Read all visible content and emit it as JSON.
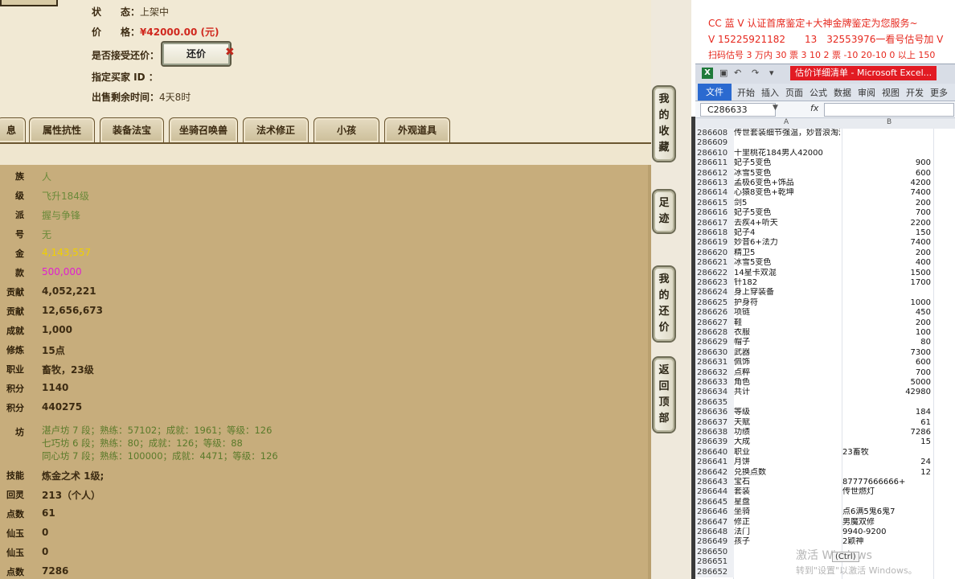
{
  "game": {
    "status": {
      "label": "状　　态：",
      "value": "上架中"
    },
    "price": {
      "label": "价　　格：",
      "value": "¥42000.00 (元)"
    },
    "counter_offer": {
      "label": "是否接受还价：",
      "button": "还价"
    },
    "buyer_id": {
      "label": "指定买家 ID ："
    },
    "remaining": {
      "label": "出售剩余时间：",
      "value": "4天8时"
    },
    "tabs": [
      "息",
      "属性抗性",
      "装备法宝",
      "坐骑召唤兽",
      "法术修正",
      "小孩",
      "外观道具"
    ],
    "side_buttons": [
      "我的收藏",
      "足迹",
      "我的还价",
      "返回顶部"
    ],
    "rows": [
      {
        "label": "族",
        "value": "人",
        "color": "#6b8a3a"
      },
      {
        "label": "级",
        "value": "飞升184级",
        "color": "#6b8a3a"
      },
      {
        "label": "派",
        "value": "握与争锋",
        "color": "#6b8a3a"
      },
      {
        "label": "号",
        "value": "无",
        "color": "#6b8a3a"
      },
      {
        "label": "金",
        "value": "4,143,557",
        "color": "#f0d000"
      },
      {
        "label": "款",
        "value": "500,000",
        "color": "#e020d0"
      },
      {
        "label": "贡献",
        "value": "4,052,221",
        "color": "#3c2b12"
      },
      {
        "label": "贡献",
        "value": "12,656,673",
        "color": "#3c2b12"
      },
      {
        "label": "成就",
        "value": "1,000",
        "color": "#3c2b12"
      },
      {
        "label": "修炼",
        "value": "15点",
        "color": "#3c2b12"
      },
      {
        "label": "职业",
        "value": "畜牧，23级",
        "color": "#3c2b12"
      },
      {
        "label": "积分",
        "value": "1140",
        "color": "#3c2b12"
      },
      {
        "label": "积分",
        "value": "440275",
        "color": "#3c2b12"
      }
    ],
    "workshop": {
      "label": "坊",
      "lines": [
        "湛卢坊 7 段；熟练：57102；成就：1961；等级：126",
        "七巧坊 6 段；熟练：80；成就：126；等级：88",
        "同心坊 7 段；熟练：100000；成就：4471；等级：126"
      ]
    },
    "rows2": [
      {
        "label": "技能",
        "value": "炼金之术 1级;"
      },
      {
        "label": "回灵",
        "value": "213（个人）"
      },
      {
        "label": "点数",
        "value": "61"
      },
      {
        "label": "仙玉",
        "value": "0"
      },
      {
        "label": "仙玉",
        "value": "0"
      },
      {
        "label": "点数",
        "value": "7286"
      }
    ]
  },
  "ads": [
    "CC 蓝 V 认证首席鉴定+大神金牌鉴定为您服务~",
    "V 15225921182　　13　32553976一看号估号加 V",
    "扫码估号 3 万内 30 票 3 10 2 票 -10 20-10 0 以上 150"
  ],
  "excel": {
    "title": "估价详细清单 - Microsoft Excel...",
    "logo": "X",
    "ribbon_tabs": [
      "文件",
      "开始",
      "插入",
      "页面",
      "公式",
      "数据",
      "审阅",
      "视图",
      "开发",
      "更多"
    ],
    "name_box": "C286633",
    "fx": "fx",
    "col_headers": [
      "A",
      "B"
    ],
    "rows": [
      {
        "n": "286608",
        "a": "传世套装细节强温，妙音浪淘沙千万杀密",
        "b": ""
      },
      {
        "n": "286609",
        "a": "",
        "b": ""
      },
      {
        "n": "286610",
        "a": "十里桃花184男人42000",
        "b": ""
      },
      {
        "n": "286611",
        "a": "妃子5变色",
        "b": "900"
      },
      {
        "n": "286612",
        "a": "冰雪5变色",
        "b": "600"
      },
      {
        "n": "286613",
        "a": "孟极6变色+饰品",
        "b": "4200"
      },
      {
        "n": "286614",
        "a": "心猿8变色+乾坤",
        "b": "7400"
      },
      {
        "n": "286615",
        "a": "剑5",
        "b": "200"
      },
      {
        "n": "286616",
        "a": "妃子5变色",
        "b": "700"
      },
      {
        "n": "286617",
        "a": "去疾4+听天",
        "b": "2200"
      },
      {
        "n": "286618",
        "a": "妃子4",
        "b": "150"
      },
      {
        "n": "286619",
        "a": "妙音6+法力",
        "b": "7400"
      },
      {
        "n": "286620",
        "a": "精卫5",
        "b": "200"
      },
      {
        "n": "286621",
        "a": "冰雪5变色",
        "b": "400"
      },
      {
        "n": "286622",
        "a": "14星卡双混",
        "b": "1500"
      },
      {
        "n": "286623",
        "a": "针182",
        "b": "1700"
      },
      {
        "n": "286624",
        "a": "身上穿装备",
        "b": ""
      },
      {
        "n": "286625",
        "a": "护身符",
        "b": "1000"
      },
      {
        "n": "286626",
        "a": "项链",
        "b": "450"
      },
      {
        "n": "286627",
        "a": "鞋",
        "b": "200"
      },
      {
        "n": "286628",
        "a": "衣服",
        "b": "100"
      },
      {
        "n": "286629",
        "a": "帽子",
        "b": "80"
      },
      {
        "n": "286630",
        "a": "武器",
        "b": "7300"
      },
      {
        "n": "286631",
        "a": "佩饰",
        "b": "600"
      },
      {
        "n": "286632",
        "a": "点粹",
        "b": "700"
      },
      {
        "n": "286633",
        "a": "角色",
        "b": "5000"
      },
      {
        "n": "286634",
        "a": "共计",
        "b": "42980"
      },
      {
        "n": "286635",
        "a": "",
        "b": ""
      },
      {
        "n": "286636",
        "a": "等级",
        "b": "184"
      },
      {
        "n": "286637",
        "a": "天赋",
        "b": "61"
      },
      {
        "n": "286638",
        "a": "功绩",
        "b": "7286"
      },
      {
        "n": "286639",
        "a": "大成",
        "b": "15"
      },
      {
        "n": "286640",
        "a": "职业",
        "b": "23畜牧"
      },
      {
        "n": "286641",
        "a": "月饼",
        "b": "24"
      },
      {
        "n": "286642",
        "a": "兑换点数",
        "b": "12"
      },
      {
        "n": "286643",
        "a": "宝石",
        "b": "87777666666+"
      },
      {
        "n": "286644",
        "a": "套装",
        "b": "传世燃灯"
      },
      {
        "n": "286645",
        "a": "星盘",
        "b": ""
      },
      {
        "n": "286646",
        "a": "坐骑",
        "b": "点6满5鬼6鬼7"
      },
      {
        "n": "286647",
        "a": "修正",
        "b": "男魔双修"
      },
      {
        "n": "286648",
        "a": "法门",
        "b": "9940-9200"
      },
      {
        "n": "286649",
        "a": "孩子",
        "b": "2颖神"
      },
      {
        "n": "286650",
        "a": "",
        "b": ""
      },
      {
        "n": "286651",
        "a": "",
        "b": ""
      },
      {
        "n": "286652",
        "a": "",
        "b": ""
      }
    ],
    "watermark1": "激活 Windows",
    "watermark2": "转到\"设置\"以激活 Windows。",
    "paste_tip": "(Ctrl)"
  }
}
